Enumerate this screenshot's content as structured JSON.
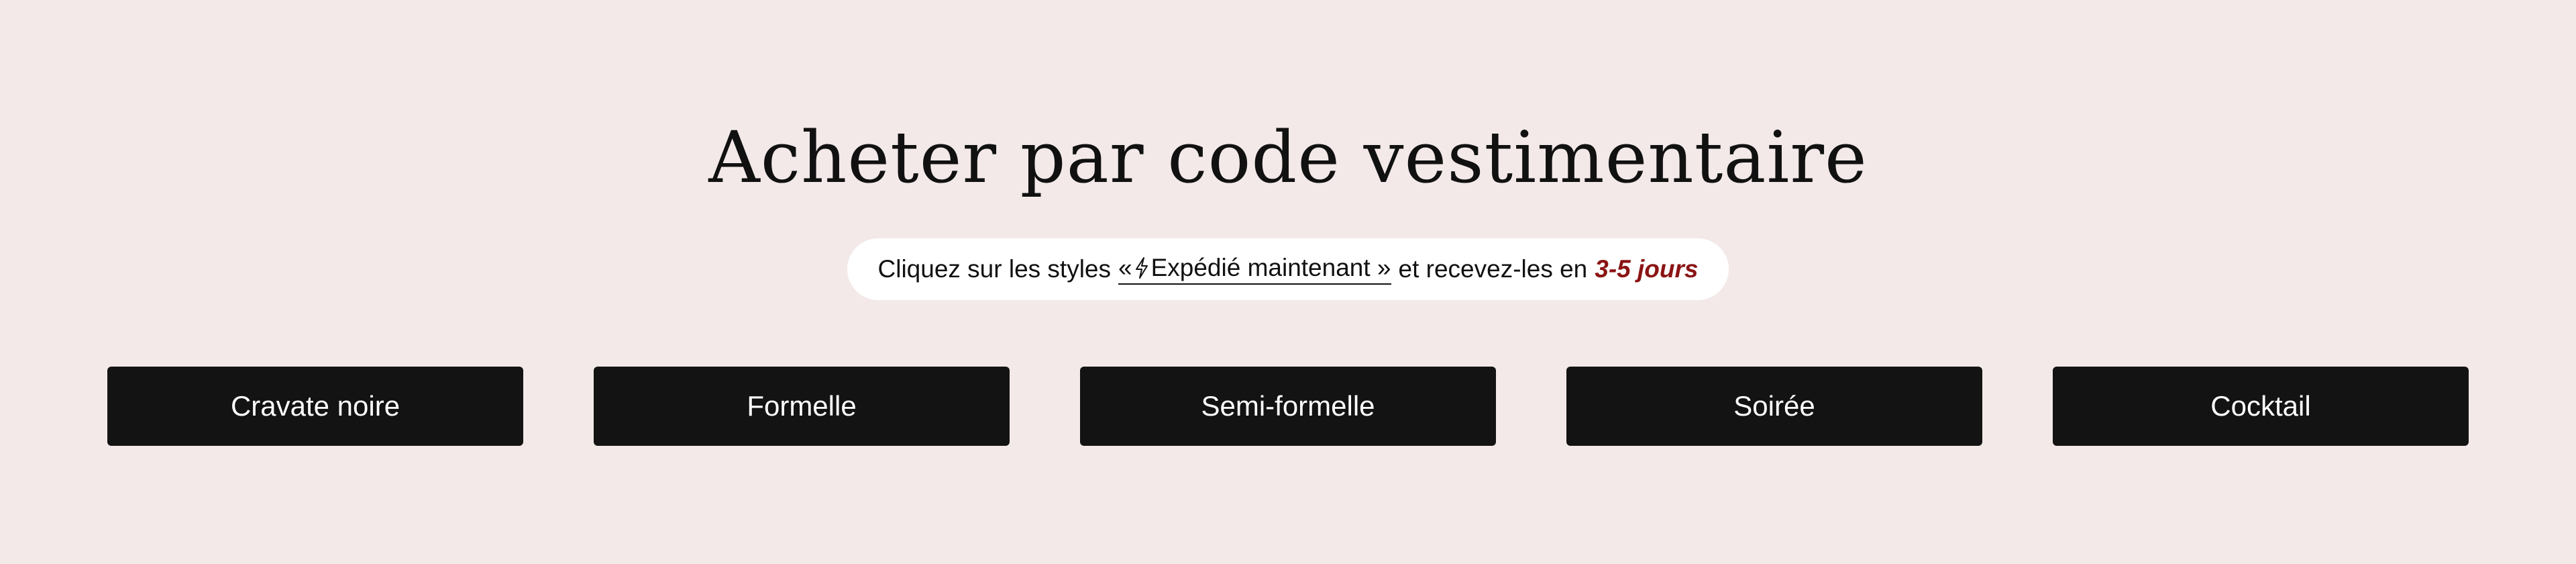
{
  "section": {
    "title": "Acheter par code vestimentaire",
    "notice": {
      "prefix": "Cliquez sur les styles",
      "link_open": "«",
      "link_text": "Expédié maintenant »",
      "middle": "et recevez-les en",
      "days": "3-5 jours",
      "icon": "lightning-bolt-icon"
    },
    "buttons": [
      {
        "label": "Cravate noire"
      },
      {
        "label": "Formelle"
      },
      {
        "label": "Semi-formelle"
      },
      {
        "label": "Soirée"
      },
      {
        "label": "Cocktail"
      }
    ]
  },
  "colors": {
    "background": "#f2e9e8",
    "button": "#131313",
    "button_text": "#ffffff",
    "accent": "#8b1414",
    "pill": "#ffffff"
  }
}
